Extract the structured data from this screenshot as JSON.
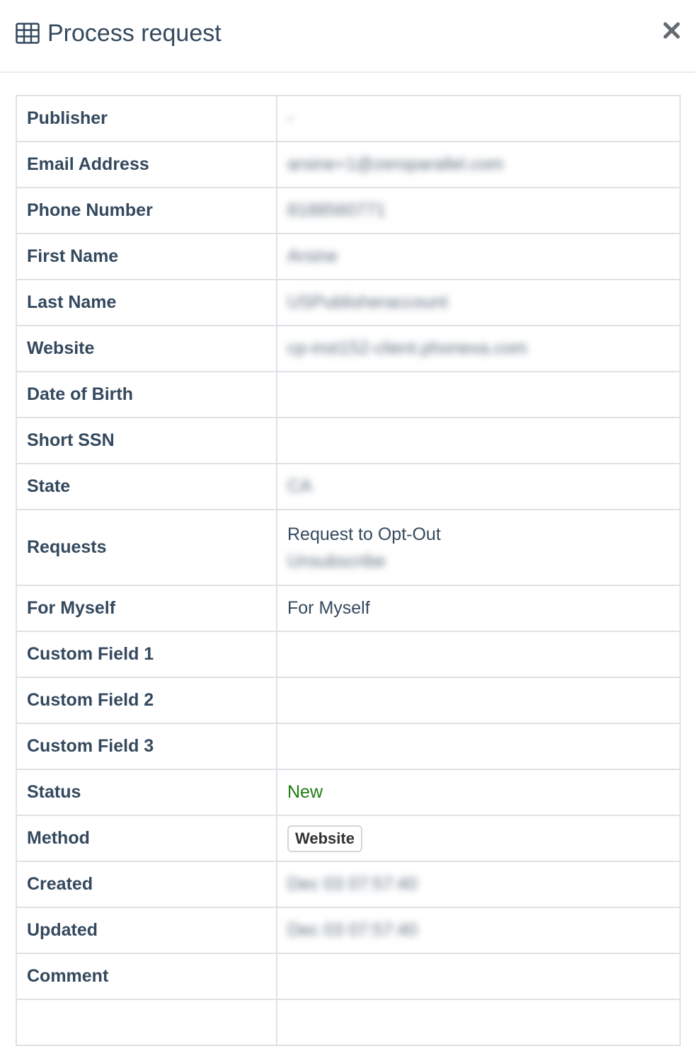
{
  "modal": {
    "title": "Process request",
    "icon": "table-icon",
    "close_icon": "close-icon"
  },
  "rows": {
    "publisher": {
      "label": "Publisher",
      "value": "-"
    },
    "email": {
      "label": "Email Address",
      "value": "arsine+1@zeroparallel.com"
    },
    "phone": {
      "label": "Phone Number",
      "value": "8188560771"
    },
    "first_name": {
      "label": "First Name",
      "value": "Arsine"
    },
    "last_name": {
      "label": "Last Name",
      "value": "USPublisheraccount"
    },
    "website": {
      "label": "Website",
      "value": "cp-inst152-client.phonexa.com"
    },
    "dob": {
      "label": "Date of Birth",
      "value": ""
    },
    "ssn": {
      "label": "Short SSN",
      "value": ""
    },
    "state": {
      "label": "State",
      "value": "CA"
    },
    "requests": {
      "label": "Requests",
      "value_primary": "Request to Opt-Out",
      "value_secondary": "Unsubscribe"
    },
    "for_myself": {
      "label": "For Myself",
      "value": "For Myself"
    },
    "custom1": {
      "label": "Custom Field 1",
      "value": ""
    },
    "custom2": {
      "label": "Custom Field 2",
      "value": ""
    },
    "custom3": {
      "label": "Custom Field 3",
      "value": ""
    },
    "status": {
      "label": "Status",
      "value": "New",
      "color": "#1e7e11"
    },
    "method": {
      "label": "Method",
      "value": "Website"
    },
    "created": {
      "label": "Created",
      "value": "Dec 03 07:57:40"
    },
    "updated": {
      "label": "Updated",
      "value": "Dec 03 07:57:40"
    },
    "comment": {
      "label": "Comment",
      "value": ""
    }
  }
}
